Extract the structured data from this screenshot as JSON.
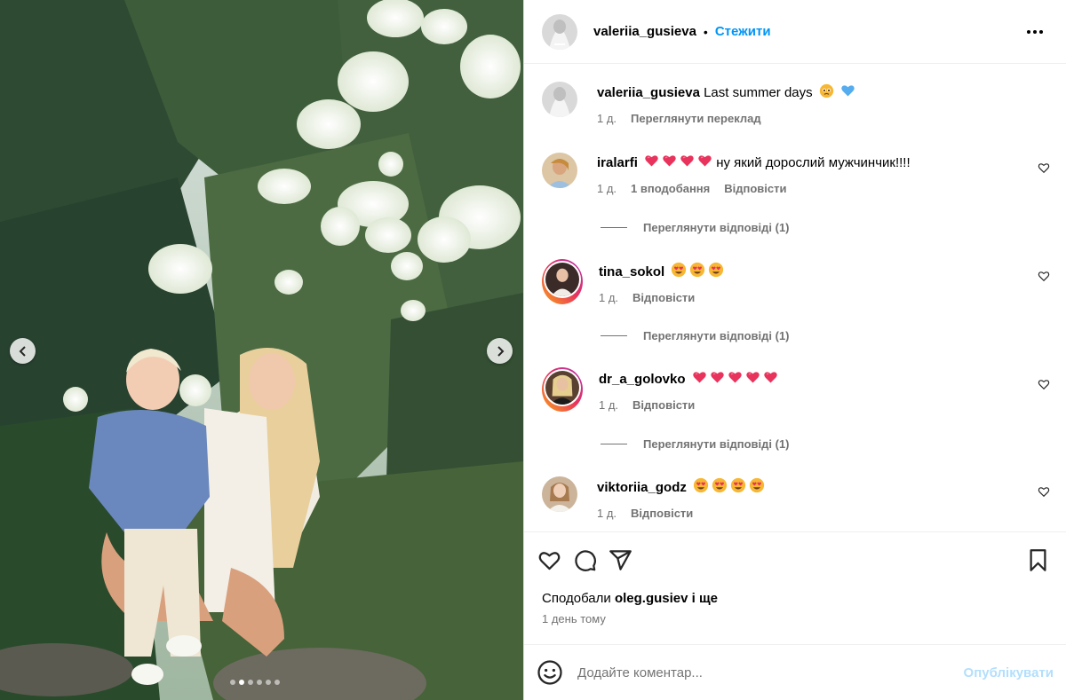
{
  "post": {
    "author": "valeriia_gusieva",
    "separator": "•",
    "follow_label": "Стежити",
    "caption_author": "valeriia_gusieva",
    "caption_text": "Last summer days",
    "caption_time": "1 д.",
    "translate_label": "Переглянути переклад",
    "image_count": 6,
    "active_image": 1
  },
  "comments": [
    {
      "user": "iralarfi",
      "text": "ну який дорослий мужчинчик!!!!",
      "emojis": [
        "heart",
        "heart",
        "heart",
        "heart"
      ],
      "time": "1 д.",
      "likes": "1 вподобання",
      "reply_label": "Відповісти",
      "view_replies": "Переглянути відповіді (1)"
    },
    {
      "user": "tina_sokol",
      "text": "",
      "emojis": [
        "heart-eyes",
        "heart-eyes",
        "heart-eyes"
      ],
      "time": "1 д.",
      "reply_label": "Відповісти",
      "view_replies": "Переглянути відповіді (1)"
    },
    {
      "user": "dr_a_golovko",
      "text": "",
      "emojis": [
        "heart",
        "heart",
        "heart",
        "heart",
        "heart"
      ],
      "time": "1 д.",
      "reply_label": "Відповісти",
      "view_replies": "Переглянути відповіді (1)"
    },
    {
      "user": "viktoriia_godz",
      "text": "",
      "emojis": [
        "heart-eyes",
        "heart-eyes",
        "heart-eyes",
        "heart-eyes"
      ],
      "time": "1 д.",
      "reply_label": "Відповісти"
    }
  ],
  "likes": {
    "prefix": "Сподобали",
    "user": "oleg.gusiev",
    "suffix": "і ще"
  },
  "post_date": "1 день тому",
  "add_comment": {
    "placeholder": "Додайте коментар...",
    "post_label": "Опублікувати"
  },
  "colors": {
    "link_blue": "#0095f6",
    "post_disabled": "#b2dffc",
    "meta_gray": "#737373",
    "heart_red": "#e8335c"
  },
  "icons": [
    "chevron-left-icon",
    "chevron-right-icon",
    "more-icon",
    "like-icon",
    "comment-icon",
    "share-icon",
    "bookmark-icon",
    "emoji-icon"
  ]
}
